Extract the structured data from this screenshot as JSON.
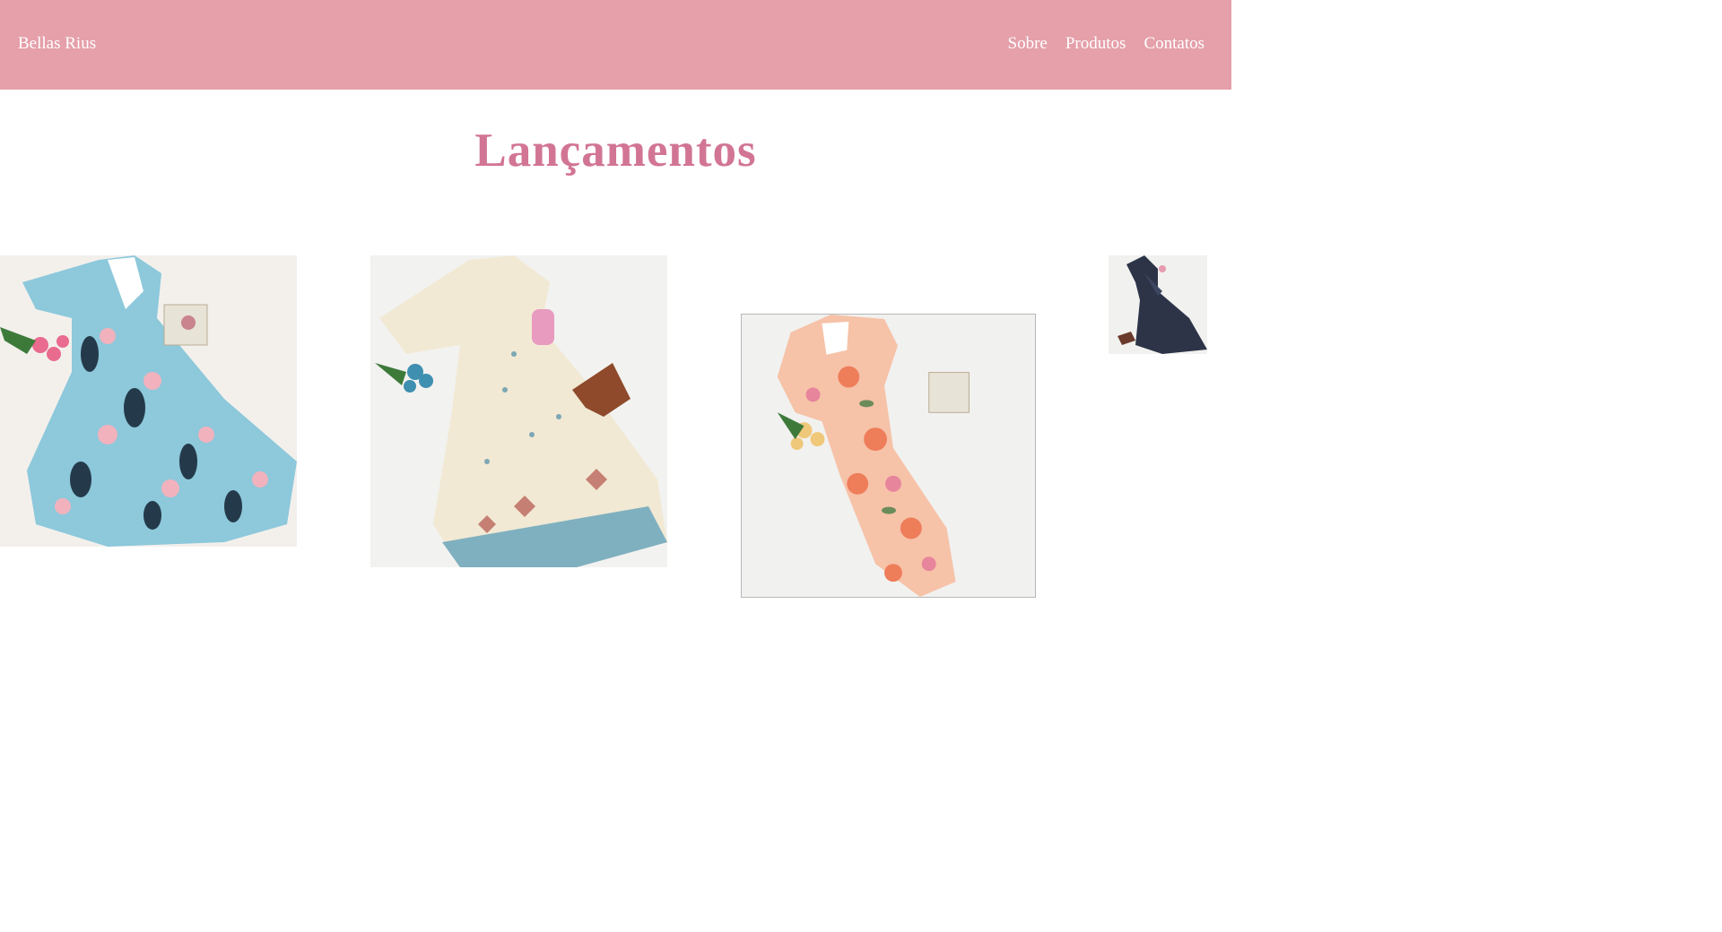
{
  "header": {
    "brand": "Bellas Rius",
    "nav": [
      "Sobre",
      "Produtos",
      "Contatos"
    ],
    "background_color": "#e5a0aa"
  },
  "main": {
    "title": "Lançamentos",
    "title_color": "#d27595",
    "products": [
      {
        "image": "light-blue floral dress photo"
      },
      {
        "image": "cream butterfly-print dress photo"
      },
      {
        "image": "peach floral dress photo"
      },
      {
        "image": "navy dress photo"
      }
    ]
  }
}
